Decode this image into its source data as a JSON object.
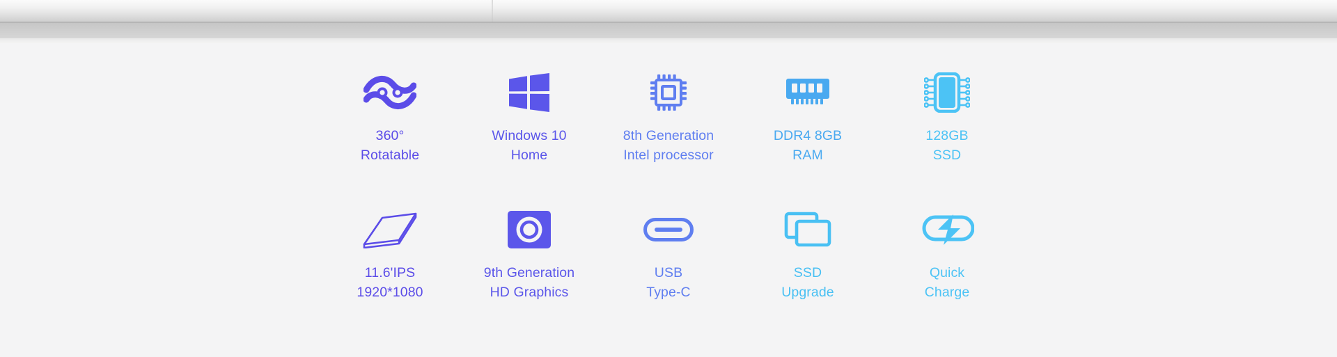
{
  "page": {
    "background_color": "#f4f4f5",
    "banner_alt": "laptop-edge-photo-strip"
  },
  "features": {
    "row1": [
      {
        "id": "rotatable",
        "icon": "hinge-360-rotate-icon",
        "line1": "360°",
        "line2": "Rotatable",
        "color": "#5b4ce8"
      },
      {
        "id": "os",
        "icon": "windows-logo-icon",
        "line1": "Windows 10",
        "line2": "Home",
        "color": "#5b56ea"
      },
      {
        "id": "cpu-gen",
        "icon": "cpu-chip-icon",
        "line1": "8th Generation",
        "line2": "Intel processor",
        "color": "#5f7ef0"
      },
      {
        "id": "ram",
        "icon": "memory-module-icon",
        "line1": "DDR4 8GB",
        "line2": "RAM",
        "color": "#49a9f0"
      },
      {
        "id": "storage",
        "icon": "ssd-chip-icon",
        "line1": "128GB",
        "line2": "SSD",
        "color": "#4cc3f5"
      }
    ],
    "row2": [
      {
        "id": "display",
        "icon": "screen-panel-icon",
        "line1": "11.6'IPS",
        "line2": "1920*1080",
        "color": "#5b4ce8"
      },
      {
        "id": "gpu",
        "icon": "graphics-lens-icon",
        "line1": "9th Generation",
        "line2": "HD Graphics",
        "color": "#5b56ea"
      },
      {
        "id": "usb-port",
        "icon": "usb-type-c-port-icon",
        "line1": "USB",
        "line2": "Type-C",
        "color": "#5f7ef0"
      },
      {
        "id": "ssd-upgrade",
        "icon": "stacked-drives-icon",
        "line1": "SSD",
        "line2": "Upgrade",
        "color": "#49c0f3"
      },
      {
        "id": "quick-charge",
        "icon": "battery-lightning-icon",
        "line1": "Quick",
        "line2": "Charge",
        "color": "#4cc3f5"
      }
    ]
  },
  "palette": {
    "indigo": "#5b4ce8",
    "violet": "#5b56ea",
    "blue": "#5f7ef0",
    "sky": "#49a9f0",
    "cyan": "#4cc3f5",
    "background": "#f4f4f5"
  }
}
